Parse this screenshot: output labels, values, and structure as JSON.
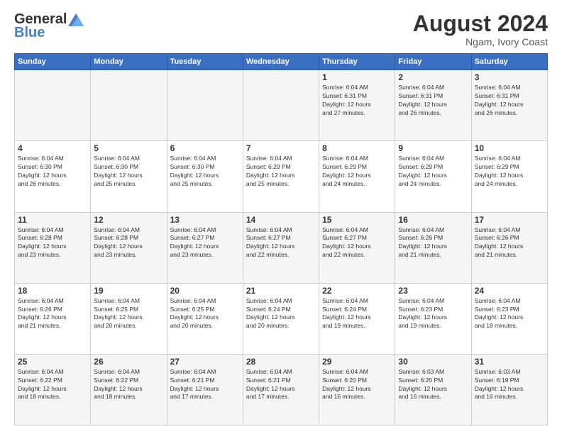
{
  "header": {
    "logo_line1": "General",
    "logo_line2": "Blue",
    "month_title": "August 2024",
    "location": "Ngam, Ivory Coast"
  },
  "calendar": {
    "days_of_week": [
      "Sunday",
      "Monday",
      "Tuesday",
      "Wednesday",
      "Thursday",
      "Friday",
      "Saturday"
    ],
    "weeks": [
      [
        {
          "day": "",
          "info": ""
        },
        {
          "day": "",
          "info": ""
        },
        {
          "day": "",
          "info": ""
        },
        {
          "day": "",
          "info": ""
        },
        {
          "day": "1",
          "info": "Sunrise: 6:04 AM\nSunset: 6:31 PM\nDaylight: 12 hours\nand 27 minutes."
        },
        {
          "day": "2",
          "info": "Sunrise: 6:04 AM\nSunset: 6:31 PM\nDaylight: 12 hours\nand 26 minutes."
        },
        {
          "day": "3",
          "info": "Sunrise: 6:04 AM\nSunset: 6:31 PM\nDaylight: 12 hours\nand 26 minutes."
        }
      ],
      [
        {
          "day": "4",
          "info": "Sunrise: 6:04 AM\nSunset: 6:30 PM\nDaylight: 12 hours\nand 26 minutes."
        },
        {
          "day": "5",
          "info": "Sunrise: 6:04 AM\nSunset: 6:30 PM\nDaylight: 12 hours\nand 25 minutes."
        },
        {
          "day": "6",
          "info": "Sunrise: 6:04 AM\nSunset: 6:30 PM\nDaylight: 12 hours\nand 25 minutes."
        },
        {
          "day": "7",
          "info": "Sunrise: 6:04 AM\nSunset: 6:29 PM\nDaylight: 12 hours\nand 25 minutes."
        },
        {
          "day": "8",
          "info": "Sunrise: 6:04 AM\nSunset: 6:29 PM\nDaylight: 12 hours\nand 24 minutes."
        },
        {
          "day": "9",
          "info": "Sunrise: 6:04 AM\nSunset: 6:29 PM\nDaylight: 12 hours\nand 24 minutes."
        },
        {
          "day": "10",
          "info": "Sunrise: 6:04 AM\nSunset: 6:29 PM\nDaylight: 12 hours\nand 24 minutes."
        }
      ],
      [
        {
          "day": "11",
          "info": "Sunrise: 6:04 AM\nSunset: 6:28 PM\nDaylight: 12 hours\nand 23 minutes."
        },
        {
          "day": "12",
          "info": "Sunrise: 6:04 AM\nSunset: 6:28 PM\nDaylight: 12 hours\nand 23 minutes."
        },
        {
          "day": "13",
          "info": "Sunrise: 6:04 AM\nSunset: 6:27 PM\nDaylight: 12 hours\nand 23 minutes."
        },
        {
          "day": "14",
          "info": "Sunrise: 6:04 AM\nSunset: 6:27 PM\nDaylight: 12 hours\nand 22 minutes."
        },
        {
          "day": "15",
          "info": "Sunrise: 6:04 AM\nSunset: 6:27 PM\nDaylight: 12 hours\nand 22 minutes."
        },
        {
          "day": "16",
          "info": "Sunrise: 6:04 AM\nSunset: 6:26 PM\nDaylight: 12 hours\nand 21 minutes."
        },
        {
          "day": "17",
          "info": "Sunrise: 6:04 AM\nSunset: 6:26 PM\nDaylight: 12 hours\nand 21 minutes."
        }
      ],
      [
        {
          "day": "18",
          "info": "Sunrise: 6:04 AM\nSunset: 6:26 PM\nDaylight: 12 hours\nand 21 minutes."
        },
        {
          "day": "19",
          "info": "Sunrise: 6:04 AM\nSunset: 6:25 PM\nDaylight: 12 hours\nand 20 minutes."
        },
        {
          "day": "20",
          "info": "Sunrise: 6:04 AM\nSunset: 6:25 PM\nDaylight: 12 hours\nand 20 minutes."
        },
        {
          "day": "21",
          "info": "Sunrise: 6:04 AM\nSunset: 6:24 PM\nDaylight: 12 hours\nand 20 minutes."
        },
        {
          "day": "22",
          "info": "Sunrise: 6:04 AM\nSunset: 6:24 PM\nDaylight: 12 hours\nand 19 minutes."
        },
        {
          "day": "23",
          "info": "Sunrise: 6:04 AM\nSunset: 6:23 PM\nDaylight: 12 hours\nand 19 minutes."
        },
        {
          "day": "24",
          "info": "Sunrise: 6:04 AM\nSunset: 6:23 PM\nDaylight: 12 hours\nand 18 minutes."
        }
      ],
      [
        {
          "day": "25",
          "info": "Sunrise: 6:04 AM\nSunset: 6:22 PM\nDaylight: 12 hours\nand 18 minutes."
        },
        {
          "day": "26",
          "info": "Sunrise: 6:04 AM\nSunset: 6:22 PM\nDaylight: 12 hours\nand 18 minutes."
        },
        {
          "day": "27",
          "info": "Sunrise: 6:04 AM\nSunset: 6:21 PM\nDaylight: 12 hours\nand 17 minutes."
        },
        {
          "day": "28",
          "info": "Sunrise: 6:04 AM\nSunset: 6:21 PM\nDaylight: 12 hours\nand 17 minutes."
        },
        {
          "day": "29",
          "info": "Sunrise: 6:04 AM\nSunset: 6:20 PM\nDaylight: 12 hours\nand 16 minutes."
        },
        {
          "day": "30",
          "info": "Sunrise: 6:03 AM\nSunset: 6:20 PM\nDaylight: 12 hours\nand 16 minutes."
        },
        {
          "day": "31",
          "info": "Sunrise: 6:03 AM\nSunset: 6:19 PM\nDaylight: 12 hours\nand 16 minutes."
        }
      ]
    ]
  }
}
